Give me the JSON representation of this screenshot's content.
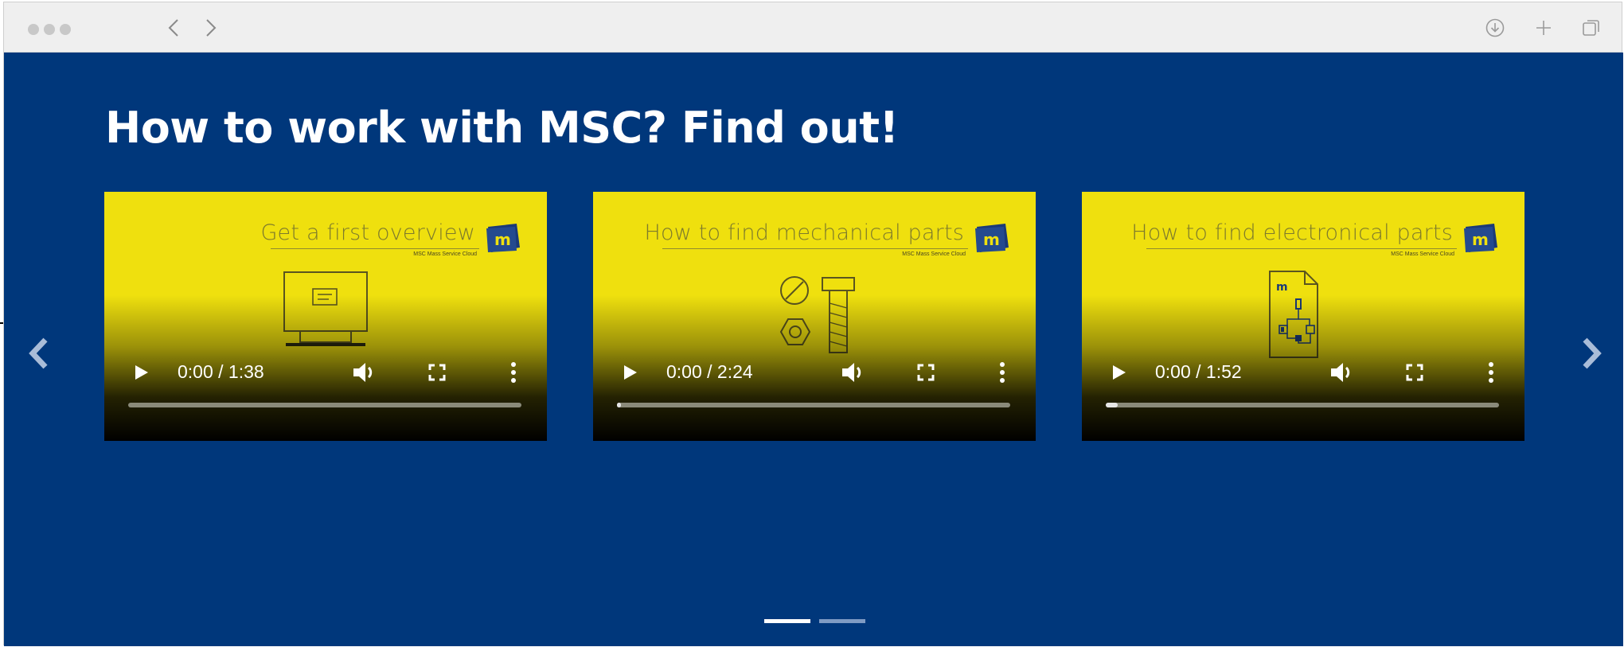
{
  "browser": {
    "back_icon": "chevron-left-icon",
    "forward_icon": "chevron-right-icon",
    "download_icon": "download-icon",
    "new_tab_icon": "plus-icon",
    "tabs_icon": "tabs-icon"
  },
  "section": {
    "title": "How to work with MSC? Find out!"
  },
  "colors": {
    "background": "#00377b",
    "thumbnail": "#efe00e",
    "accent_logo": "#1b3a77"
  },
  "videos": [
    {
      "thumb_title": "Get a first overview",
      "thumb_subtitle": "MSC Mass Service Cloud",
      "logo_letter": "m",
      "time": "0:00 / 1:38",
      "progress": 0.0,
      "illustration": "monitor-illustration"
    },
    {
      "thumb_title": "How to find mechanical parts",
      "thumb_subtitle": "MSC Mass Service Cloud",
      "logo_letter": "m",
      "time": "0:00 / 2:24",
      "progress": 0.01,
      "illustration": "bolt-nut-illustration"
    },
    {
      "thumb_title": "How to find electronical parts",
      "thumb_subtitle": "MSC Mass Service Cloud",
      "logo_letter": "m",
      "time": "0:00 / 1:52",
      "progress": 0.03,
      "illustration": "circuit-document-illustration"
    }
  ],
  "carousel": {
    "prev_icon": "chevron-left-icon",
    "next_icon": "chevron-right-icon",
    "active_index": 0,
    "slide_count": 2
  }
}
